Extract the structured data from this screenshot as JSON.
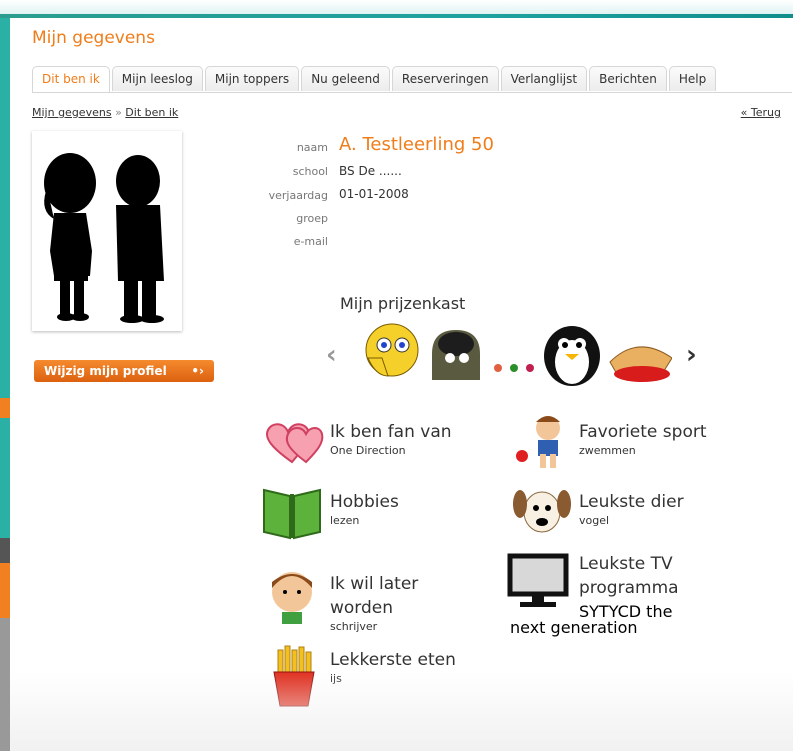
{
  "page": {
    "title": "Mijn gegevens"
  },
  "tabs": [
    "Dit ben ik",
    "Mijn leeslog",
    "Mijn toppers",
    "Nu geleend",
    "Reserveringen",
    "Verlanglijst",
    "Berichten",
    "Help"
  ],
  "breadcrumb": {
    "root": "Mijn gegevens",
    "sep": "»",
    "current": "Dit ben ik",
    "back": "« Terug"
  },
  "profile": {
    "edit_label": "Wijzig mijn profiel",
    "edit_arrow": "•›",
    "labels": {
      "naam": "naam",
      "school": "school",
      "verjaardag": "verjaardag",
      "groep": "groep",
      "email": "e-mail"
    },
    "name": "A. Testleerling 50",
    "school": "BS De ......",
    "birthday": "01-01-2008"
  },
  "prize_cabinet": {
    "title": "Mijn prijzenkast",
    "prev": "‹",
    "next": "›"
  },
  "favorites": [
    {
      "title": "Ik ben fan van",
      "value": "One Direction"
    },
    {
      "title": "Favoriete sport",
      "value": "zwemmen"
    },
    {
      "title": "Hobbies",
      "value": "lezen"
    },
    {
      "title": "Leukste dier",
      "value": "vogel"
    },
    {
      "title": "Ik wil later worden",
      "value": "schrijver"
    },
    {
      "title": "Leukste TV programma",
      "value": "SYTYCD the next generation"
    },
    {
      "title": "Lekkerste eten",
      "value": "ijs"
    }
  ],
  "colors": {
    "accent": "#f07d1a",
    "teal": "#1ea2a0"
  }
}
